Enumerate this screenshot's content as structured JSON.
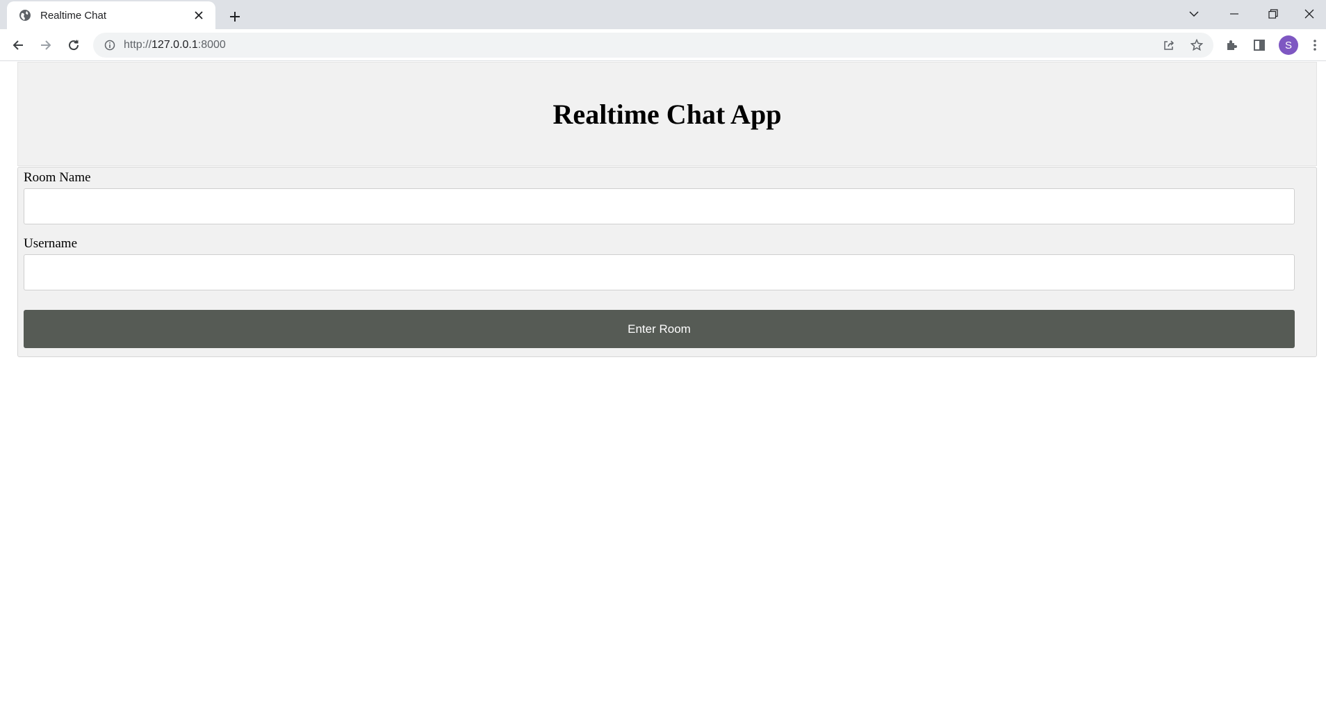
{
  "browser": {
    "tab": {
      "title": "Realtime Chat"
    },
    "omnibox": {
      "url_scheme": "http://",
      "url_host": "127.0.0.1",
      "url_rest": ":8000"
    },
    "profile_initial": "S",
    "colors": {
      "profile": "#7e57c2",
      "tabstrip": "#dee1e6"
    }
  },
  "page": {
    "title": "Realtime Chat App",
    "form": {
      "room_label": "Room Name",
      "room_value": "",
      "username_label": "Username",
      "username_value": "",
      "submit_label": "Enter Room"
    },
    "colors": {
      "button": "#565b55",
      "panel": "#f1f1f1"
    }
  }
}
